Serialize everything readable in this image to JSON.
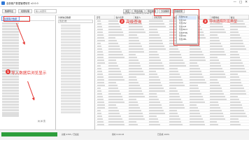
{
  "window": {
    "title": "全部客户数据管理软件  v2.0.0",
    "controls": [
      "—",
      "□",
      "✕"
    ]
  },
  "toolbar": {
    "left_buttons": [
      "数据导出",
      "批量处理"
    ],
    "search_placeholder": "输入关键词",
    "right_buttons": [
      "清空",
      "导出表格",
      "导出类型",
      "分割保存",
      "高级搜索"
    ],
    "status_line": "筛选条件 2021-04-28  共 9785 条"
  },
  "left_panel": {
    "tab_label": "全部客户数据",
    "footer": "共 并 页"
  },
  "mid_panel": {
    "title": "分类信息数据",
    "filter": "筛选分类"
  },
  "table": {
    "columns": [
      "序号",
      "客户名称",
      "联系人",
      "手机号码",
      "电话",
      "所在地区",
      "详细地址",
      "备注"
    ]
  },
  "dropdown": {
    "items": [
      "导出Excel",
      "导出TXT",
      "导出CSV",
      "导出VCF",
      "导出Word",
      "导出HTML",
      "导出SQL",
      "导出XML"
    ],
    "active_index": 0
  },
  "statusbar": {
    "progress": 1.0,
    "progress_color": "#2e9e3c",
    "segments": [
      "总数 9785 / 已加载",
      "用时 0:00:03",
      "已完成 100%"
    ]
  },
  "annotations": {
    "badge_1": "1",
    "label_1": "导入数据后浏览显示",
    "badge_2": "2",
    "label_2": "高级查询",
    "badge_3": "3",
    "label_3": "导出选择所需类型",
    "accent_color": "#e53935"
  }
}
